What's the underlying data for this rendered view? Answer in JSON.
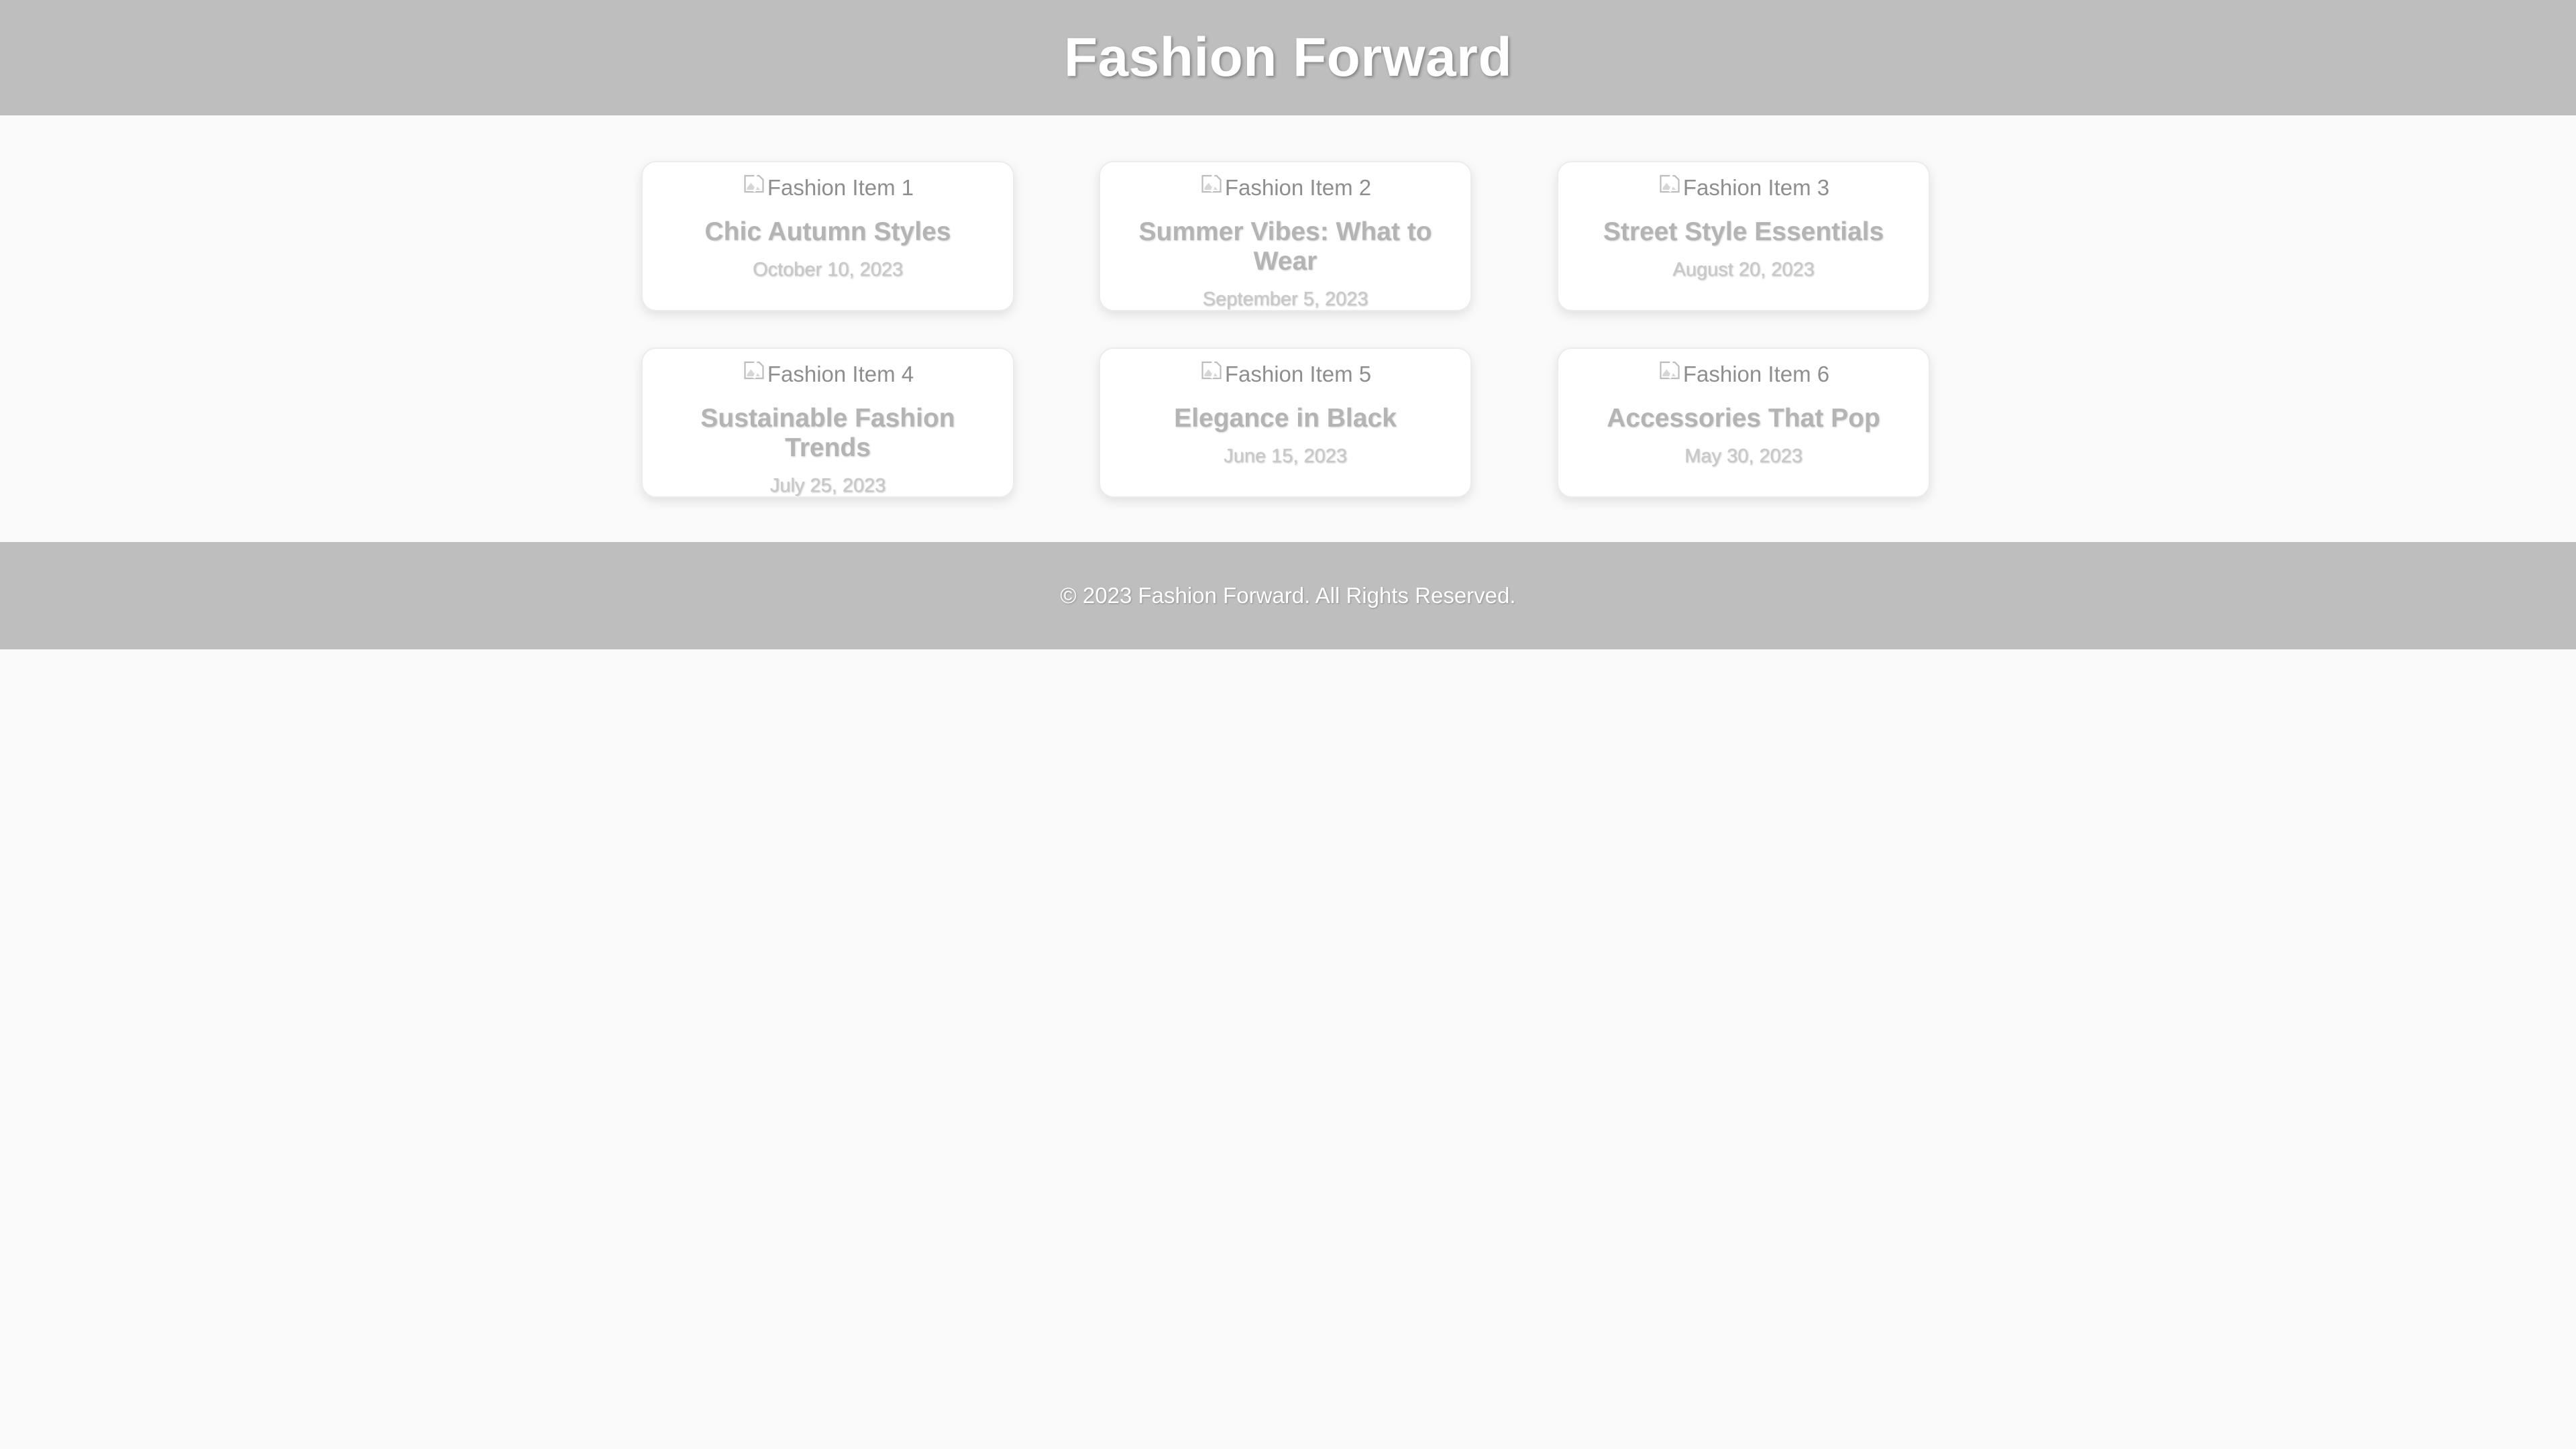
{
  "header": {
    "title": "Fashion Forward"
  },
  "cards": [
    {
      "image_alt": "Fashion Item 1",
      "title": "Chic Autumn Styles",
      "date": "October 10, 2023"
    },
    {
      "image_alt": "Fashion Item 2",
      "title": "Summer Vibes: What to Wear",
      "date": "September 5, 2023"
    },
    {
      "image_alt": "Fashion Item 3",
      "title": "Street Style Essentials",
      "date": "August 20, 2023"
    },
    {
      "image_alt": "Fashion Item 4",
      "title": "Sustainable Fashion Trends",
      "date": "July 25, 2023"
    },
    {
      "image_alt": "Fashion Item 5",
      "title": "Elegance in Black",
      "date": "June 15, 2023"
    },
    {
      "image_alt": "Fashion Item 6",
      "title": "Accessories That Pop",
      "date": "May 30, 2023"
    }
  ],
  "footer": {
    "text": "© 2023 Fashion Forward. All Rights Reserved."
  },
  "icons": {
    "broken_image": "broken-image-icon"
  },
  "colors": {
    "header_bg": "#bebebe",
    "footer_bg": "#bebebe",
    "page_bg": "#fafafa",
    "card_bg": "#ffffff"
  }
}
